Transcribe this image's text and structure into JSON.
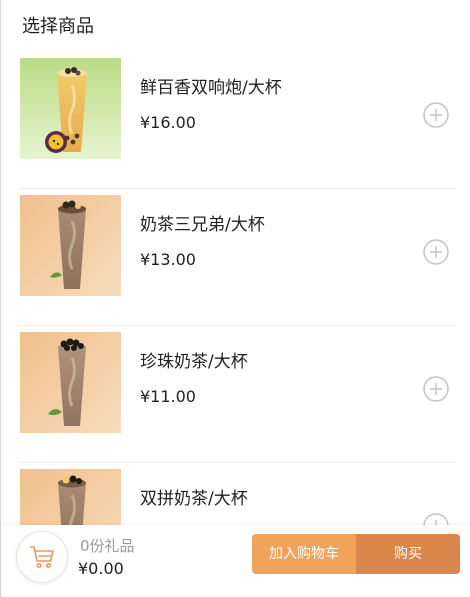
{
  "header": {
    "title": "选择商品"
  },
  "products": [
    {
      "name": "鲜百香双响炮/大杯",
      "price": "¥16.00",
      "image_icon": "passion-fruit-tea-image"
    },
    {
      "name": "奶茶三兄弟/大杯",
      "price": "¥13.00",
      "image_icon": "milk-tea-trio-image"
    },
    {
      "name": "珍珠奶茶/大杯",
      "price": "¥11.00",
      "image_icon": "pearl-milk-tea-image"
    },
    {
      "name": "双拼奶茶/大杯",
      "price": "",
      "image_icon": "double-milk-tea-image"
    }
  ],
  "cart": {
    "gift_count": "0份礼品",
    "total": "¥0.00",
    "icon": "shopping-cart-icon"
  },
  "actions": {
    "add_to_cart": "加入购物车",
    "buy": "购买"
  },
  "colors": {
    "add_to_cart_bg": "#f0a45b",
    "buy_bg": "#d9874c",
    "cart_icon": "#e89a5a",
    "plus_icon": "#c2c2c2"
  }
}
